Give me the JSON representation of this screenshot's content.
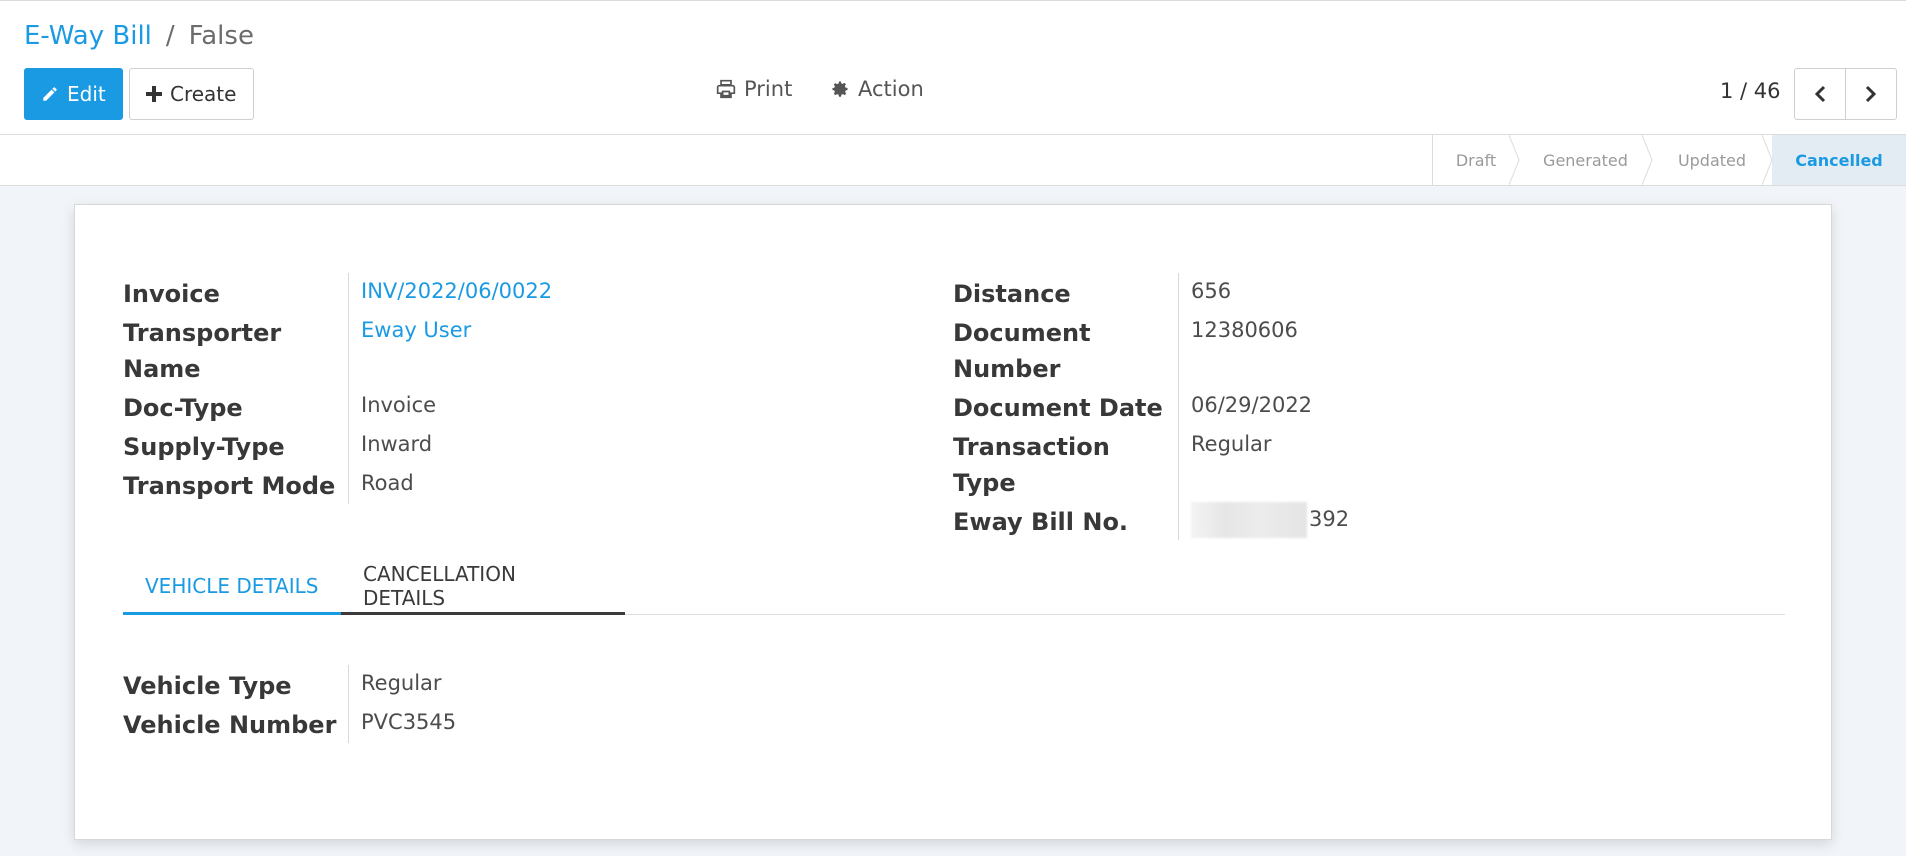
{
  "breadcrumb": {
    "parent": "E-Way Bill",
    "separator": "/",
    "current": "False"
  },
  "buttons": {
    "edit": "Edit",
    "create": "Create"
  },
  "tools": {
    "print": "Print",
    "action": "Action"
  },
  "pager": {
    "value": "1 / 46"
  },
  "statusbar": {
    "steps": [
      "Draft",
      "Generated",
      "Updated",
      "Cancelled"
    ],
    "active": "Cancelled"
  },
  "form": {
    "left": [
      {
        "label": "Invoice",
        "value": "INV/2022/06/0022"
      },
      {
        "label_line1": "Transporter",
        "label_line2": "Name",
        "value": "Eway User"
      },
      {
        "label": "Doc-Type",
        "value": "Invoice"
      },
      {
        "label": "Supply-Type",
        "value": "Inward"
      },
      {
        "label": "Transport Mode",
        "value": "Road"
      }
    ],
    "right": [
      {
        "label": "Distance",
        "value": "656"
      },
      {
        "label_line1": "Document",
        "label_line2": "Number",
        "value": "12380606"
      },
      {
        "label": "Document Date",
        "value": "06/29/2022"
      },
      {
        "label": "Transaction Type",
        "value": "Regular"
      },
      {
        "label": "Eway Bill No.",
        "value_visible": "392"
      }
    ]
  },
  "tabs": {
    "vehicle": "VEHICLE DETAILS",
    "cancellation": "CANCELLATION DETAILS"
  },
  "vehicle": [
    {
      "label": "Vehicle Type",
      "value": "Regular"
    },
    {
      "label": "Vehicle Number",
      "value": "PVC3545"
    }
  ],
  "colors": {
    "accent": "#1b9ae4",
    "active_step_bg": "#e4ecf3"
  },
  "icons": {
    "edit": "pencil-icon",
    "create": "plus-icon",
    "print": "printer-icon",
    "action": "gear-icon",
    "prev": "chevron-left-icon",
    "next": "chevron-right-icon"
  }
}
